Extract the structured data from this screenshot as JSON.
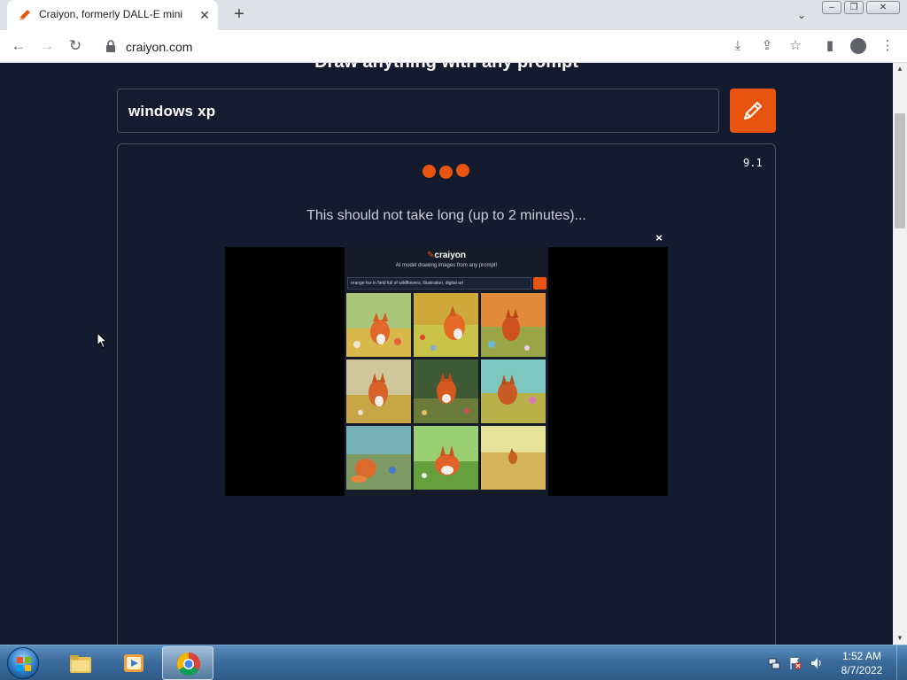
{
  "browser": {
    "tab": {
      "title": "Craiyon, formerly DALL-E mini",
      "favicon": "pencil-icon"
    },
    "url": "craiyon.com"
  },
  "page": {
    "heading": "Draw anything with any prompt",
    "prompt_value": "windows xp",
    "version": "9.1",
    "wait_message": "This should not take long (up to 2 minutes)...",
    "ad": {
      "logo": "craiyon",
      "subtitle": "AI model drawing images from any prompt!",
      "prompt": "orange fox in field full of wildflowers, illustration, digital art",
      "close": "×"
    }
  },
  "taskbar": {
    "time": "1:52 AM",
    "date": "8/7/2022"
  },
  "colors": {
    "accent": "#e8530e",
    "background": "#131b2e"
  }
}
